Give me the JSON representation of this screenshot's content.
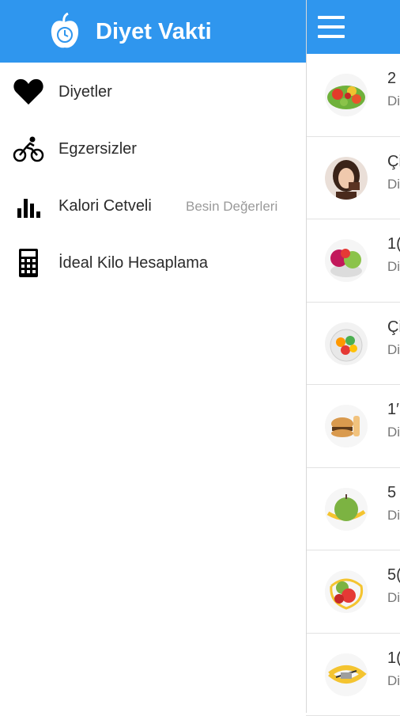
{
  "app": {
    "title": "Diyet Vakti"
  },
  "colors": {
    "primary": "#2f96ee",
    "text": "#2b2b2b",
    "muted": "#9a9a9a"
  },
  "drawer": {
    "items": [
      {
        "label": "Diyetler",
        "icon": "heart-icon"
      },
      {
        "label": "Egzersizler",
        "icon": "cyclist-icon"
      },
      {
        "label": "Kalori Cetveli",
        "extra": "Besin Değerleri",
        "icon": "bar-chart-icon"
      },
      {
        "label": "İdeal Kilo Hesaplama",
        "icon": "calculator-icon"
      }
    ]
  },
  "main": {
    "menu_icon": "hamburger-icon",
    "list": [
      {
        "title": "2",
        "subtitle": "Di",
        "image": "salad-bowl"
      },
      {
        "title": "Çi",
        "subtitle": "Di",
        "image": "woman-eating"
      },
      {
        "title": "1(",
        "subtitle": "Di",
        "image": "fruits-scale"
      },
      {
        "title": "Çi",
        "subtitle": "Di",
        "image": "fruit-plate"
      },
      {
        "title": "1′",
        "subtitle": "Di",
        "image": "burger-fries"
      },
      {
        "title": "5",
        "subtitle": "Di",
        "image": "green-apple-tape"
      },
      {
        "title": "5(",
        "subtitle": "Di",
        "image": "apples-tape"
      },
      {
        "title": "1(",
        "subtitle": "Di",
        "image": "measuring-tape"
      }
    ]
  }
}
